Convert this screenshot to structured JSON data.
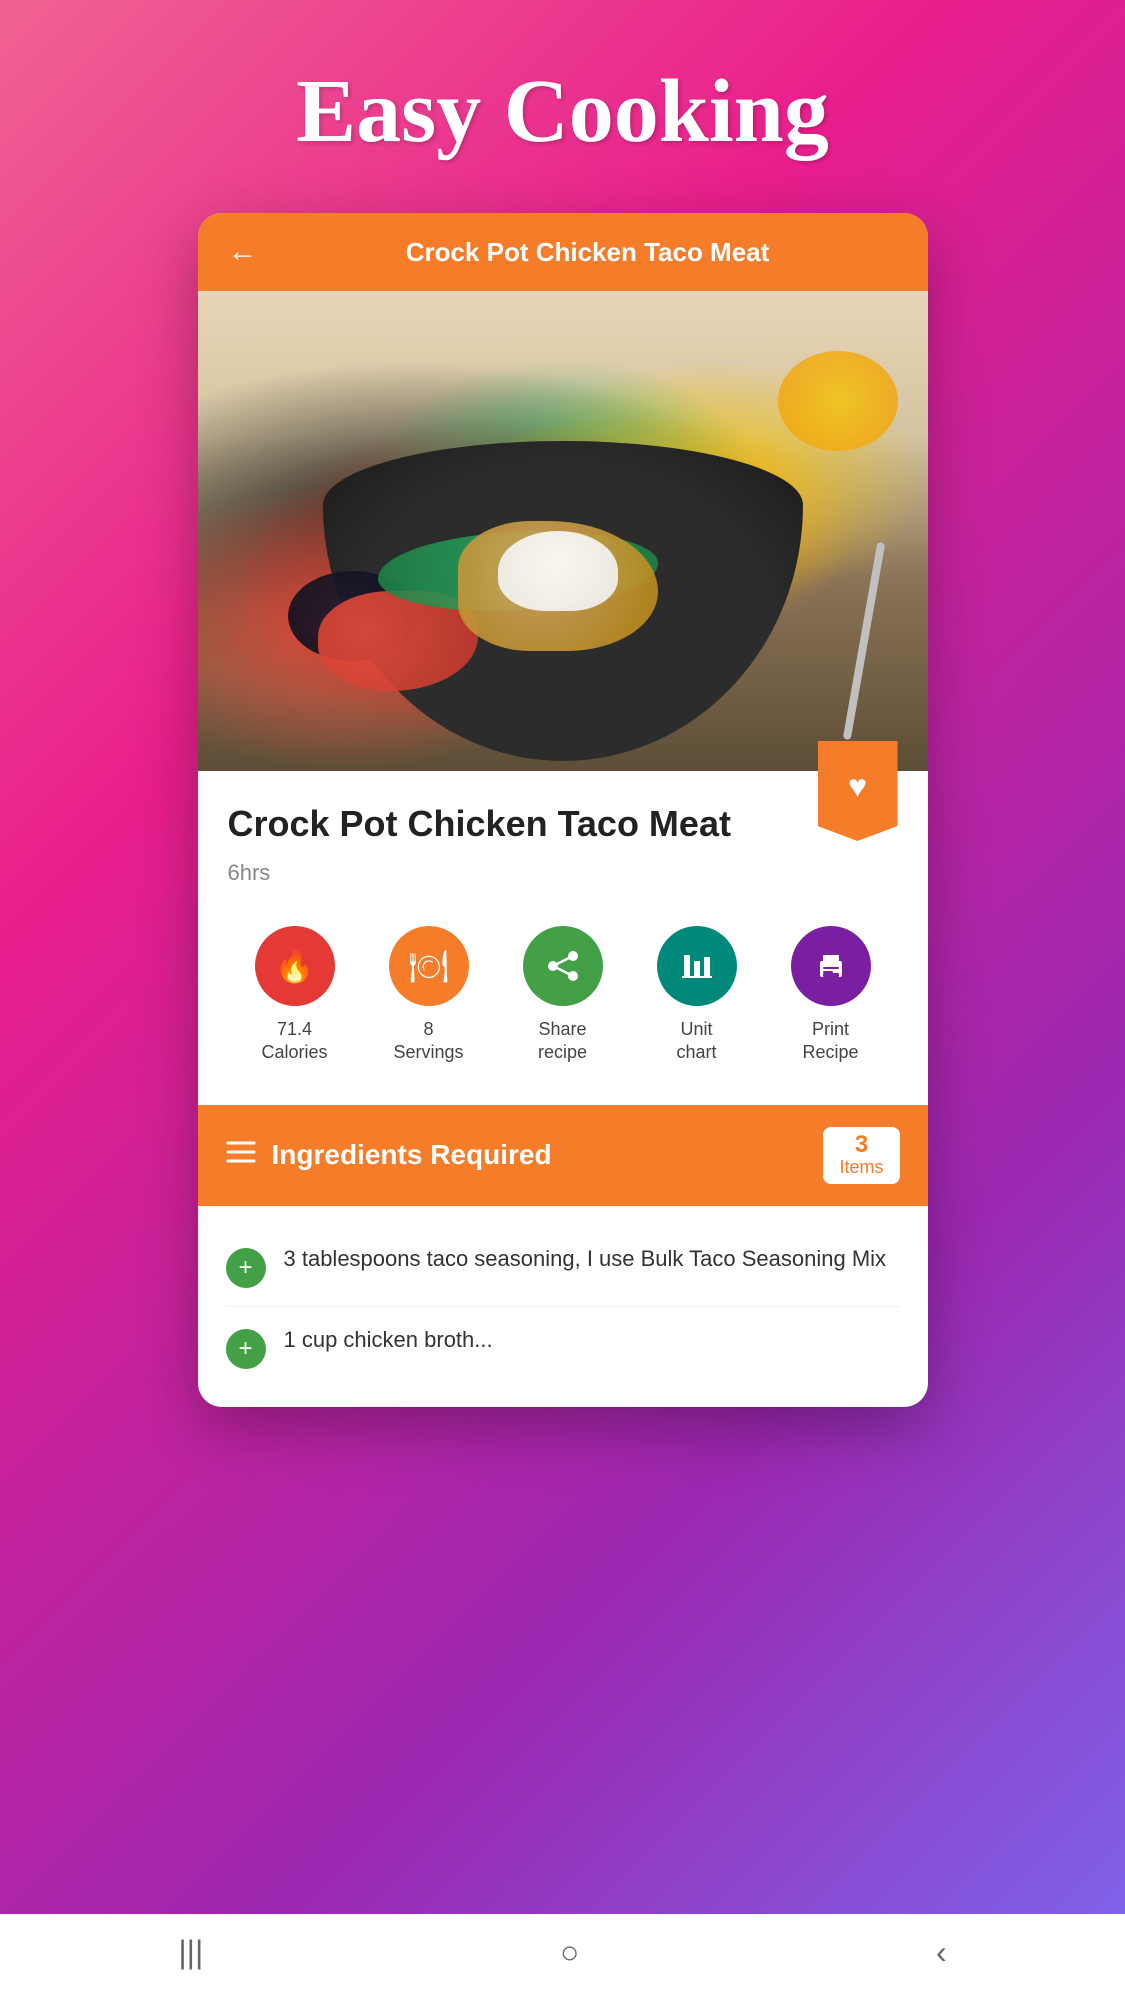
{
  "page": {
    "title": "Easy Cooking"
  },
  "header": {
    "back_label": "←",
    "title": "Crock Pot Chicken Taco Meat"
  },
  "recipe": {
    "title": "Crock Pot Chicken Taco Meat",
    "time": "6hrs",
    "bookmark_icon": "♥"
  },
  "actions": [
    {
      "id": "calories",
      "value": "71.4",
      "label": "Calories",
      "circle_class": "circle-red",
      "icon": "🔥"
    },
    {
      "id": "servings",
      "value": "8",
      "label": "Servings",
      "circle_class": "circle-orange",
      "icon": "🍽"
    },
    {
      "id": "share",
      "value": "Share",
      "label": "recipe",
      "circle_class": "circle-green",
      "icon": "share"
    },
    {
      "id": "unit",
      "value": "Unit",
      "label": "chart",
      "circle_class": "circle-teal",
      "icon": "📋"
    },
    {
      "id": "print",
      "value": "Print",
      "label": "Recipe",
      "circle_class": "circle-purple",
      "icon": "🖨"
    }
  ],
  "ingredients": {
    "header_title": "Ingredients Required",
    "count_number": "3",
    "count_label": "Items",
    "items": [
      {
        "id": 1,
        "text": "3 tablespoons taco seasoning, I use Bulk Taco Seasoning Mix"
      },
      {
        "id": 2,
        "text": "1 cup chicken broth..."
      }
    ]
  },
  "bottom_nav": {
    "icons": [
      "|||",
      "○",
      "‹"
    ]
  },
  "colors": {
    "orange": "#F57C28",
    "red": "#e53935",
    "green": "#43a047",
    "teal": "#00897b",
    "purple": "#7b1fa2",
    "background_gradient_start": "#f06292",
    "background_gradient_end": "#7b68ee"
  }
}
